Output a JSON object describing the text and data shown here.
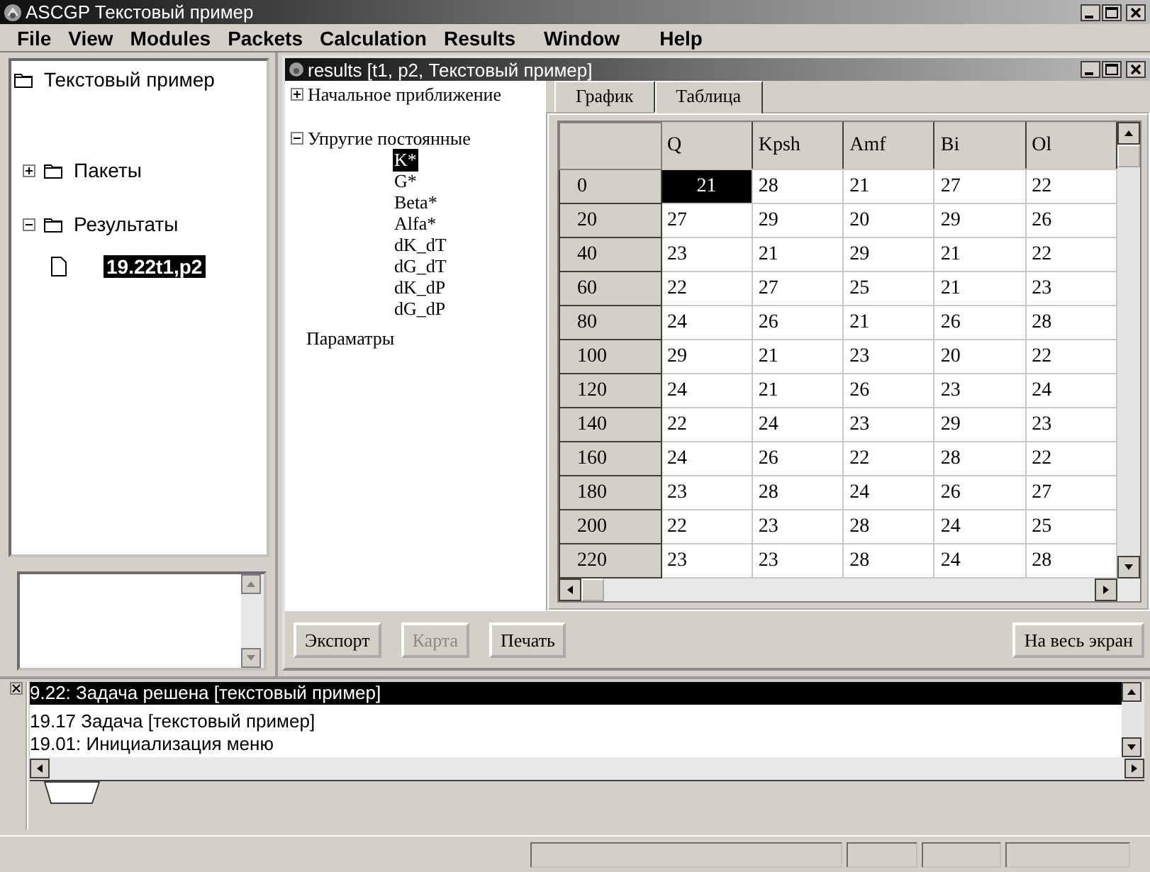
{
  "window": {
    "title": "ASCGP Текстовый пример"
  },
  "menu": [
    "File",
    "View",
    "Modules",
    "Packets",
    "Calculation",
    "Results",
    "Window",
    "Help"
  ],
  "project_tree": {
    "label": "Текстовый пример",
    "selected": false,
    "children": [
      {
        "label": "Пакеты",
        "expanded": false,
        "selected": false
      },
      {
        "label": "Результаты",
        "expanded": true,
        "selected": false,
        "children": [
          {
            "label": "19.22t1,p2",
            "selected": true
          }
        ]
      }
    ]
  },
  "results_window": {
    "title": "results [t1, p2, Текстовый пример]",
    "param_tree": [
      {
        "label": "Начальное приближение",
        "expanded": false,
        "selected": false
      },
      {
        "label": "Упругие постоянные",
        "expanded": true,
        "selected": false,
        "children": [
          {
            "label": "K*",
            "selected": true
          },
          {
            "label": "G*",
            "selected": false
          },
          {
            "label": "Beta*",
            "selected": false
          },
          {
            "label": "Alfa*",
            "selected": false
          },
          {
            "label": "dK_dT",
            "selected": false
          },
          {
            "label": "dG_dT",
            "selected": false
          },
          {
            "label": "dK_dP",
            "selected": false
          },
          {
            "label": "dG_dP",
            "selected": false
          }
        ]
      },
      {
        "label": "Параматры",
        "selected": false
      }
    ],
    "tabs": [
      {
        "label": "График",
        "selected": false
      },
      {
        "label": "Таблица",
        "selected": true
      }
    ],
    "table": {
      "columns": [
        "Q",
        "Kpsh",
        "Amf",
        "Bi",
        "Ol"
      ],
      "rows": [
        {
          "header": "0",
          "cells": [
            {
              "text": "21",
              "selected": true
            },
            {
              "text": "28",
              "selected": false
            },
            {
              "text": "21",
              "selected": false
            },
            {
              "text": "27",
              "selected": false
            },
            {
              "text": "22",
              "selected": false
            }
          ]
        },
        {
          "header": "20",
          "cells": [
            {
              "text": "27",
              "selected": false
            },
            {
              "text": "29",
              "selected": false
            },
            {
              "text": "20",
              "selected": false
            },
            {
              "text": "29",
              "selected": false
            },
            {
              "text": "26",
              "selected": false
            }
          ]
        },
        {
          "header": "40",
          "cells": [
            {
              "text": "23",
              "selected": false
            },
            {
              "text": "21",
              "selected": false
            },
            {
              "text": "29",
              "selected": false
            },
            {
              "text": "21",
              "selected": false
            },
            {
              "text": "22",
              "selected": false
            }
          ]
        },
        {
          "header": "60",
          "cells": [
            {
              "text": "22",
              "selected": false
            },
            {
              "text": "27",
              "selected": false
            },
            {
              "text": "25",
              "selected": false
            },
            {
              "text": "21",
              "selected": false
            },
            {
              "text": "23",
              "selected": false
            }
          ]
        },
        {
          "header": "80",
          "cells": [
            {
              "text": "24",
              "selected": false
            },
            {
              "text": "26",
              "selected": false
            },
            {
              "text": "21",
              "selected": false
            },
            {
              "text": "26",
              "selected": false
            },
            {
              "text": "28",
              "selected": false
            }
          ]
        },
        {
          "header": "100",
          "cells": [
            {
              "text": "29",
              "selected": false
            },
            {
              "text": "21",
              "selected": false
            },
            {
              "text": "23",
              "selected": false
            },
            {
              "text": "20",
              "selected": false
            },
            {
              "text": "22",
              "selected": false
            }
          ]
        },
        {
          "header": "120",
          "cells": [
            {
              "text": "24",
              "selected": false
            },
            {
              "text": "21",
              "selected": false
            },
            {
              "text": "26",
              "selected": false
            },
            {
              "text": "23",
              "selected": false
            },
            {
              "text": "24",
              "selected": false
            }
          ]
        },
        {
          "header": "140",
          "cells": [
            {
              "text": "22",
              "selected": false
            },
            {
              "text": "24",
              "selected": false
            },
            {
              "text": "23",
              "selected": false
            },
            {
              "text": "29",
              "selected": false
            },
            {
              "text": "23",
              "selected": false
            }
          ]
        },
        {
          "header": "160",
          "cells": [
            {
              "text": "24",
              "selected": false
            },
            {
              "text": "26",
              "selected": false
            },
            {
              "text": "22",
              "selected": false
            },
            {
              "text": "28",
              "selected": false
            },
            {
              "text": "22",
              "selected": false
            }
          ]
        },
        {
          "header": "180",
          "cells": [
            {
              "text": "23",
              "selected": false
            },
            {
              "text": "28",
              "selected": false
            },
            {
              "text": "24",
              "selected": false
            },
            {
              "text": "26",
              "selected": false
            },
            {
              "text": "27",
              "selected": false
            }
          ]
        },
        {
          "header": "200",
          "cells": [
            {
              "text": "22",
              "selected": false
            },
            {
              "text": "23",
              "selected": false
            },
            {
              "text": "28",
              "selected": false
            },
            {
              "text": "24",
              "selected": false
            },
            {
              "text": "25",
              "selected": false
            }
          ]
        },
        {
          "header": "220",
          "cells": [
            {
              "text": "23",
              "selected": false
            },
            {
              "text": "23",
              "selected": false
            },
            {
              "text": "28",
              "selected": false
            },
            {
              "text": "24",
              "selected": false
            },
            {
              "text": "28",
              "selected": false
            }
          ]
        }
      ]
    },
    "buttons": [
      {
        "label": "Экспорт",
        "disabled": false
      },
      {
        "label": "Карта",
        "disabled": true
      },
      {
        "label": "Печать",
        "disabled": false
      }
    ],
    "fullscreen_button": {
      "label": "На весь экран",
      "disabled": false
    }
  },
  "log": [
    {
      "text": "9.22: Задача решена [текстовый пример]",
      "selected": true
    },
    {
      "text": "19.17 Задача [текстовый пример]",
      "selected": false
    },
    {
      "text": "19.01: Инициализация меню",
      "selected": false
    }
  ]
}
